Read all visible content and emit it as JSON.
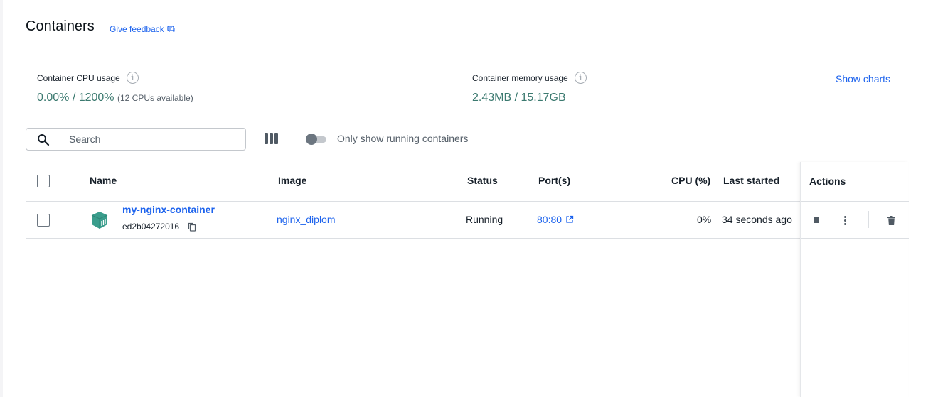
{
  "page": {
    "title": "Containers",
    "feedback_label": "Give feedback"
  },
  "stats": {
    "cpu": {
      "label": "Container CPU usage",
      "value": "0.00% / 1200%",
      "note": "(12 CPUs available)"
    },
    "memory": {
      "label": "Container memory usage",
      "value": "2.43MB / 15.17GB"
    },
    "show_charts_label": "Show charts"
  },
  "toolbar": {
    "search_placeholder": "Search",
    "search_value": "",
    "toggle_label": "Only show running containers",
    "toggle_on": false
  },
  "table": {
    "columns": {
      "name": "Name",
      "image": "Image",
      "status": "Status",
      "ports": "Port(s)",
      "cpu": "CPU (%)",
      "last_started": "Last started",
      "actions": "Actions"
    },
    "rows": [
      {
        "name": "my-nginx-container",
        "id": "ed2b04272016",
        "image": "nginx_diplom",
        "status": "Running",
        "ports": "80:80",
        "cpu": "0%",
        "last_started": "34 seconds ago"
      }
    ]
  },
  "colors": {
    "accent": "#1d63ed",
    "stat_value": "#3c7a70",
    "container_icon": "#3a9d8c"
  },
  "icons": [
    "feedback-icon",
    "info-icon",
    "search-icon",
    "columns-icon",
    "container-icon",
    "copy-icon",
    "external-link-icon",
    "stop-icon",
    "more-icon",
    "trash-icon"
  ]
}
